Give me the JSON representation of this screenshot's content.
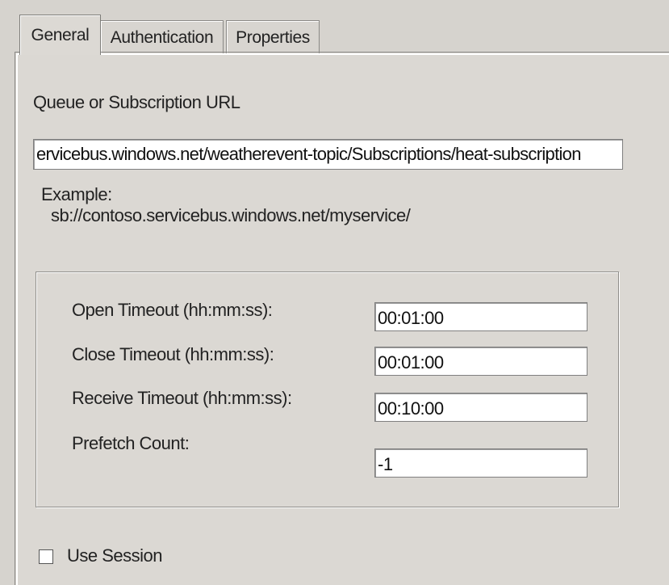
{
  "tabs": [
    {
      "label": "General",
      "active": true
    },
    {
      "label": "Authentication",
      "active": false
    },
    {
      "label": "Properties",
      "active": false
    }
  ],
  "url_section": {
    "label": "Queue or Subscription URL",
    "value": "ervicebus.windows.net/weatherevent-topic/Subscriptions/heat-subscription",
    "example_label": "Example:",
    "example_value": "sb://contoso.servicebus.windows.net/myservice/"
  },
  "timeouts": {
    "open_label": "Open Timeout (hh:mm:ss):",
    "open_value": "00:01:00",
    "close_label": "Close Timeout (hh:mm:ss):",
    "close_value": "00:01:00",
    "receive_label": "Receive Timeout (hh:mm:ss):",
    "receive_value": "00:10:00",
    "prefetch_label": "Prefetch Count:",
    "prefetch_value": "-1"
  },
  "use_session": {
    "label": "Use Session",
    "checked": false
  },
  "colors": {
    "dialog_background": "#d6d3ce",
    "input_background": "#ffffff"
  }
}
